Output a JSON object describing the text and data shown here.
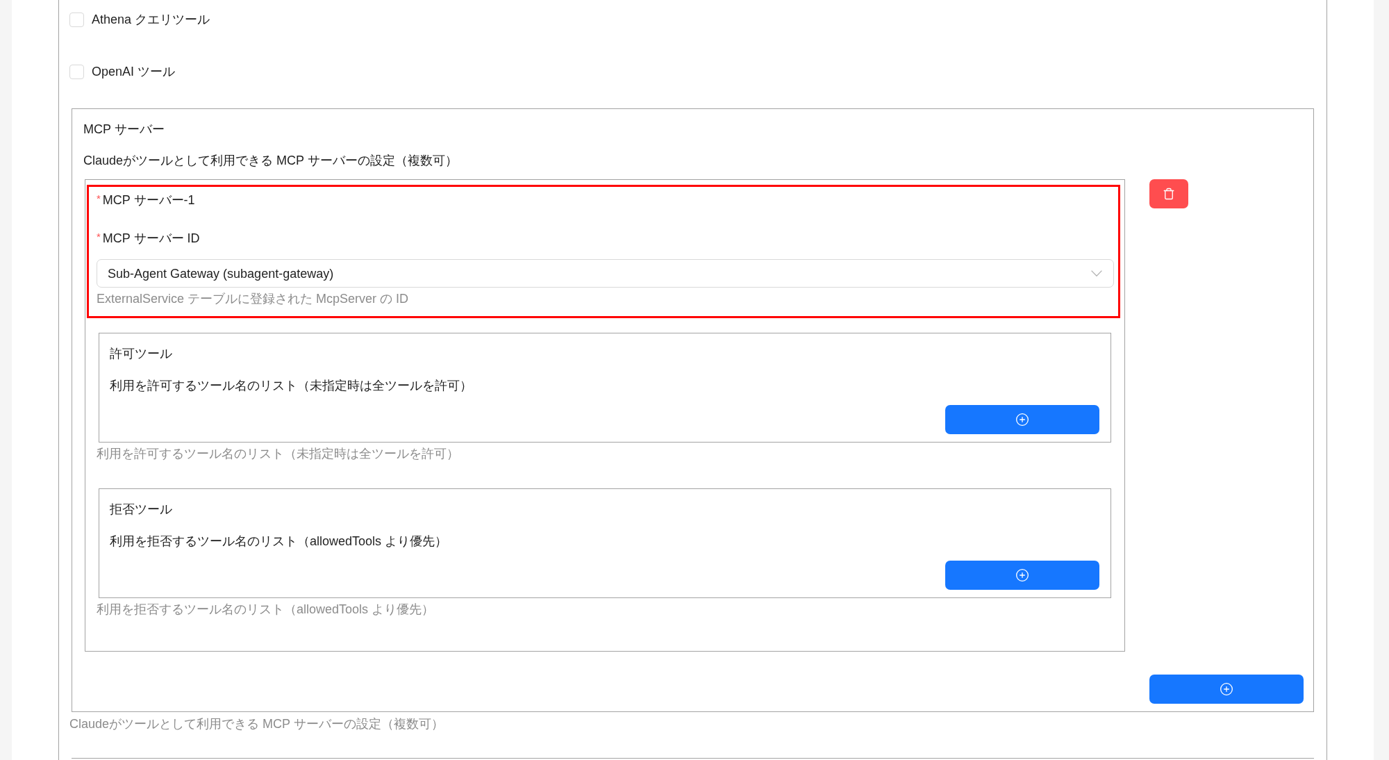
{
  "tool_options": [
    {
      "label": "Athena クエリツール",
      "checked": false
    },
    {
      "label": "OpenAI ツール",
      "checked": false
    }
  ],
  "mcp_servers_section": {
    "title": "MCP サーバー",
    "description": "Claudeがツールとして利用できる MCP サーバーの設定（複数可）",
    "servers": [
      {
        "highlighted": true,
        "title": {
          "required_mark": "*",
          "label": "MCP サーバー-1"
        },
        "id_field": {
          "required_mark": "*",
          "label": "MCP サーバー ID",
          "value": "Sub-Agent Gateway (subagent-gateway)",
          "help": "ExternalService テーブルに登録された McpServer の ID"
        },
        "tool_lists": [
          {
            "title": "許可ツール",
            "description": "利用を許可するツール名のリスト（未指定時は全ツールを許可）",
            "help": "利用を許可するツール名のリスト（未指定時は全ツールを許可）"
          },
          {
            "title": "拒否ツール",
            "description": "利用を拒否するツール名のリスト（allowedTools より優先）",
            "help": "利用を拒否するツール名のリスト（allowedTools より優先）"
          }
        ]
      }
    ],
    "help": "Claudeがツールとして利用できる MCP サーバーの設定（複数可）"
  }
}
